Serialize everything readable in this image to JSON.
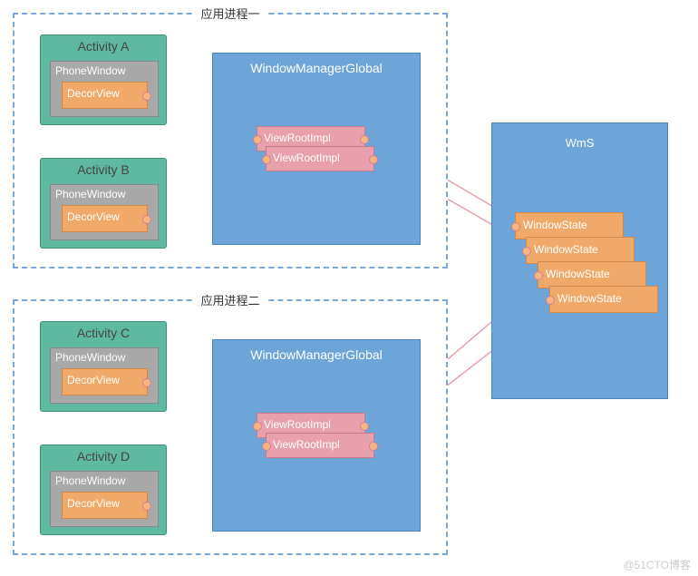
{
  "process1": {
    "label": "应用进程一",
    "activities": [
      {
        "name": "Activity A",
        "pw": "PhoneWindow",
        "dv": "DecorView"
      },
      {
        "name": "Activity B",
        "pw": "PhoneWindow",
        "dv": "DecorView"
      }
    ],
    "wmg": {
      "title": "WindowManagerGlobal",
      "vri": [
        "ViewRootImpl",
        "ViewRootImpl"
      ]
    }
  },
  "process2": {
    "label": "应用进程二",
    "activities": [
      {
        "name": "Activity C",
        "pw": "PhoneWindow",
        "dv": "DecorView"
      },
      {
        "name": "Activity D",
        "pw": "PhoneWindow",
        "dv": "DecorView"
      }
    ],
    "wmg": {
      "title": "WindowManagerGlobal",
      "vri": [
        "ViewRootImpl",
        "ViewRootImpl"
      ]
    }
  },
  "wms": {
    "title": "WmS",
    "states": [
      "WindowState",
      "WindowState",
      "WindowState",
      "WindowState"
    ]
  },
  "watermark": "@51CTO博客"
}
